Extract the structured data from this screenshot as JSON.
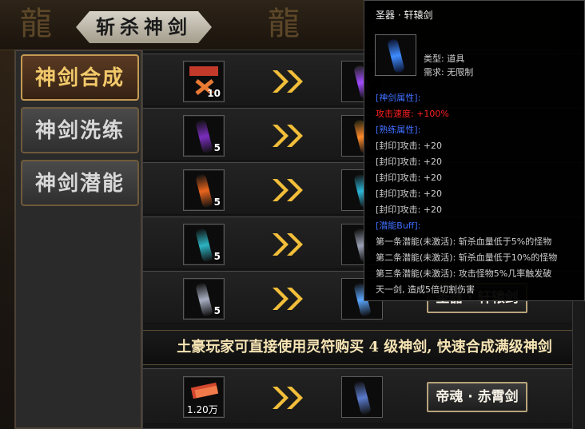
{
  "window": {
    "title": "斩杀神剑"
  },
  "tabs": [
    {
      "label": "神剑合成",
      "active": true
    },
    {
      "label": "神剑洗练",
      "active": false
    },
    {
      "label": "神剑潜能",
      "active": false
    }
  ],
  "rows": [
    {
      "qty": "10",
      "material": "boost-token",
      "target_color": "#a24bff"
    },
    {
      "qty": "5",
      "material": "purple-sword",
      "target_color": "#ff8a2a"
    },
    {
      "qty": "5",
      "material": "orange-sword",
      "target_color": "#2ab6d8"
    },
    {
      "qty": "5",
      "material": "cyan-sword",
      "target_color": "#9aa0b5"
    },
    {
      "qty": "5",
      "material": "silver-sword",
      "target_color": "#5aa6ff",
      "button": "圣器 · 轩辕剑"
    }
  ],
  "banner": {
    "text": "土豪玩家可直接使用灵符购买 4 级神剑, 快速合成满级神剑"
  },
  "buy_row": {
    "price": "1.20万",
    "button": "帝魂 · 赤霄剑"
  },
  "tooltip": {
    "title": "圣器 · 轩辕剑",
    "type": "类型: 道具",
    "requirement": "需求: 无限制",
    "sections": [
      {
        "text": "[神剑属性]:",
        "color": "#3f6fff"
      },
      {
        "text": "攻击速度: +100%",
        "color": "#ff2020"
      },
      {
        "text": "[熟练属性]:",
        "color": "#3f6fff"
      },
      {
        "text": "[封印]攻击: +20",
        "color": "#cfcfcf"
      },
      {
        "text": "[封印]攻击: +20",
        "color": "#cfcfcf"
      },
      {
        "text": "[封印]攻击: +20",
        "color": "#cfcfcf"
      },
      {
        "text": "[封印]攻击: +20",
        "color": "#cfcfcf"
      },
      {
        "text": "[封印]攻击: +20",
        "color": "#cfcfcf"
      },
      {
        "text": "[潜能Buff]:",
        "color": "#3f6fff"
      },
      {
        "text": "第一条潜能(未激活): 斩杀血量低于5%的怪物",
        "color": "#cfcfcf"
      },
      {
        "text": "第二条潜能(未激活): 斩杀血量低于10%的怪物",
        "color": "#cfcfcf"
      },
      {
        "text": "第三条潜能(未激活): 攻击怪物5%几率触发破",
        "color": "#cfcfcf"
      },
      {
        "text": "天一剑, 造成5倍切割伤害",
        "color": "#cfcfcf"
      }
    ]
  }
}
